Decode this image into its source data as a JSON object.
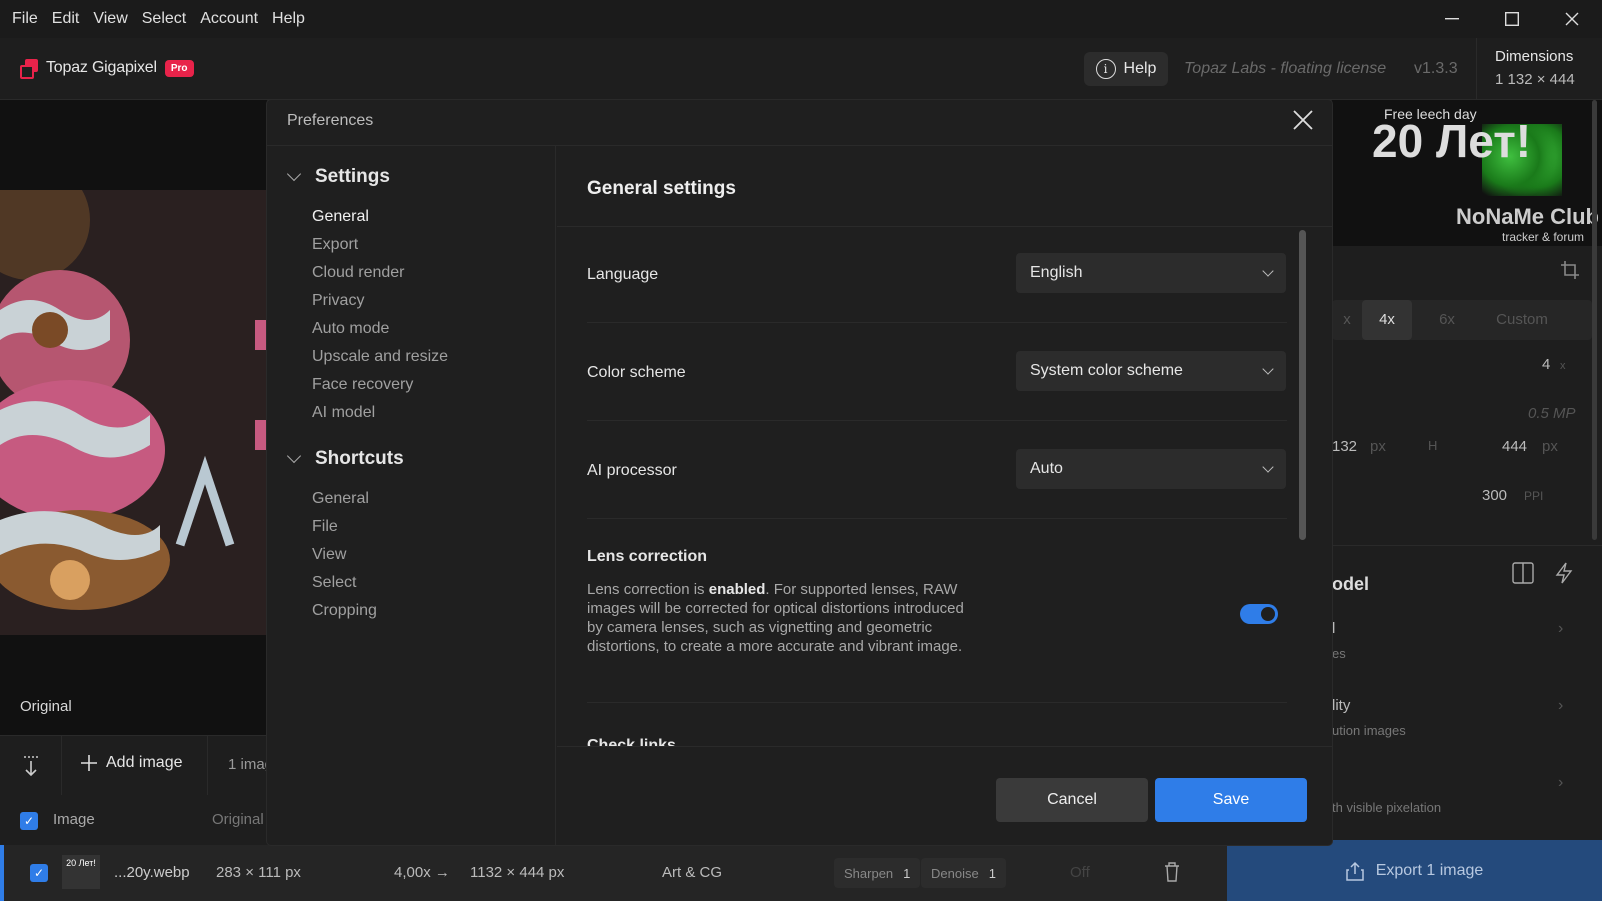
{
  "menu": [
    "File",
    "Edit",
    "View",
    "Select",
    "Account",
    "Help"
  ],
  "app": {
    "name": "Topaz Gigapixel",
    "badge": "Pro",
    "help_label": "Help",
    "license": "Topaz Labs - floating license",
    "version": "v1.3.3",
    "dimensions_label": "Dimensions",
    "dimensions_value": "1 132 × 444"
  },
  "preview": {
    "label": "Original"
  },
  "toolbar": {
    "add_image_label": "Add image",
    "image_count": "1 imag"
  },
  "table": {
    "col_image": "Image",
    "col_original": "Original"
  },
  "file_row": {
    "thumb_text": "20 Лет!",
    "name": "...20y.webp",
    "input_size": "283 × 111 px",
    "scale": "4,00x →",
    "output_size": "1132 × 444 px",
    "model": "Art & CG",
    "sharpen_label": "Sharpen",
    "sharpen_value": "1",
    "denoise_label": "Denoise",
    "denoise_value": "1",
    "off_label": "Off"
  },
  "export": {
    "label": "Export 1 image"
  },
  "right_panel": {
    "thumb_top": "Free leech day",
    "thumb_big": "20 Лет!",
    "thumb_club": "NoNaMe Club",
    "thumb_sub": "tracker & forum",
    "scales": [
      "x",
      "4x",
      "6x",
      "Custom"
    ],
    "scale_value": "4",
    "scale_unit": "x",
    "megapixels": "0.5 MP",
    "width_value": "132",
    "width_unit": "px",
    "height_label": "H",
    "height_value": "444",
    "height_unit": "px",
    "ppi_value": "300",
    "ppi_unit": "PPI",
    "model_heading": "odel",
    "item1": "l",
    "item1_sub": "es",
    "item2": "lity",
    "item2_sub": "ution images",
    "item3_sub": "th visible pixelation"
  },
  "dialog": {
    "title": "Preferences",
    "nav": {
      "settings_label": "Settings",
      "settings_items": [
        "General",
        "Export",
        "Cloud render",
        "Privacy",
        "Auto mode",
        "Upscale and resize",
        "Face recovery",
        "AI model"
      ],
      "shortcuts_label": "Shortcuts",
      "shortcuts_items": [
        "General",
        "File",
        "View",
        "Select",
        "Cropping"
      ]
    },
    "content": {
      "title": "General settings",
      "language_label": "Language",
      "language_value": "English",
      "color_scheme_label": "Color scheme",
      "color_scheme_value": "System color scheme",
      "ai_processor_label": "AI processor",
      "ai_processor_value": "Auto",
      "lens_title": "Lens correction",
      "lens_desc_before": "Lens correction is ",
      "lens_desc_bold": "enabled",
      "lens_desc_after": ". For supported lenses, RAW images will be corrected for optical distortions introduced by camera lenses, such as vignetting and geometric distortions, to create a more accurate and vibrant image.",
      "lens_enabled": true,
      "partial_heading": "Check links"
    },
    "cancel_label": "Cancel",
    "save_label": "Save"
  },
  "colors": {
    "accent": "#2f7de8",
    "brand": "#e8234a",
    "background": "#1e1e1e"
  }
}
